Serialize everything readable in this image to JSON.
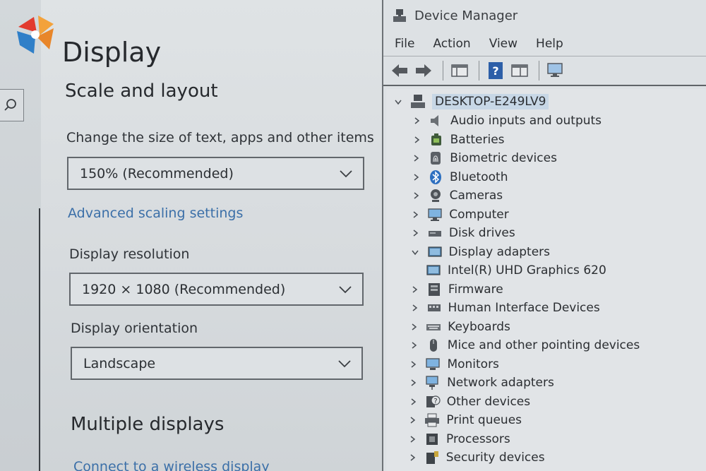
{
  "settings": {
    "page_title": "Display",
    "scale_section_title": "Scale and layout",
    "scale_label": "Change the size of text, apps and other items",
    "scale_value": "150% (Recommended)",
    "advanced_scaling_link": "Advanced scaling settings",
    "resolution_label": "Display resolution",
    "resolution_value": "1920 × 1080 (Recommended)",
    "orientation_label": "Display orientation",
    "orientation_value": "Landscape",
    "multiple_section_title": "Multiple displays",
    "wireless_link": "Connect to a wireless display"
  },
  "device_manager": {
    "title": "Device Manager",
    "menu": [
      "File",
      "Action",
      "View",
      "Help"
    ],
    "root": "DESKTOP-E249LV9",
    "categories": [
      {
        "label": "Audio inputs and outputs",
        "icon": "speaker-icon",
        "expanded": false
      },
      {
        "label": "Batteries",
        "icon": "battery-icon",
        "expanded": false
      },
      {
        "label": "Biometric devices",
        "icon": "fingerprint-icon",
        "expanded": false
      },
      {
        "label": "Bluetooth",
        "icon": "bluetooth-icon",
        "expanded": false
      },
      {
        "label": "Cameras",
        "icon": "camera-icon",
        "expanded": false
      },
      {
        "label": "Computer",
        "icon": "computer-icon",
        "expanded": false
      },
      {
        "label": "Disk drives",
        "icon": "disk-drive-icon",
        "expanded": false
      },
      {
        "label": "Display adapters",
        "icon": "display-adapter-icon",
        "expanded": true
      },
      {
        "label": "Intel(R) UHD Graphics 620",
        "icon": "display-adapter-icon",
        "child": true
      },
      {
        "label": "Firmware",
        "icon": "firmware-icon",
        "expanded": false
      },
      {
        "label": "Human Interface Devices",
        "icon": "hid-icon",
        "expanded": false
      },
      {
        "label": "Keyboards",
        "icon": "keyboard-icon",
        "expanded": false
      },
      {
        "label": "Mice and other pointing devices",
        "icon": "mouse-icon",
        "expanded": false
      },
      {
        "label": "Monitors",
        "icon": "monitor-icon",
        "expanded": false
      },
      {
        "label": "Network adapters",
        "icon": "network-adapter-icon",
        "expanded": false
      },
      {
        "label": "Other devices",
        "icon": "unknown-device-icon",
        "expanded": false
      },
      {
        "label": "Print queues",
        "icon": "printer-icon",
        "expanded": false
      },
      {
        "label": "Processors",
        "icon": "processor-icon",
        "expanded": false
      },
      {
        "label": "Security devices",
        "icon": "security-device-icon",
        "expanded": false
      }
    ]
  },
  "colors": {
    "link": "#3b6fa8",
    "root_highlight": "#c7d7e6",
    "help_icon": "#2d5fa8"
  }
}
